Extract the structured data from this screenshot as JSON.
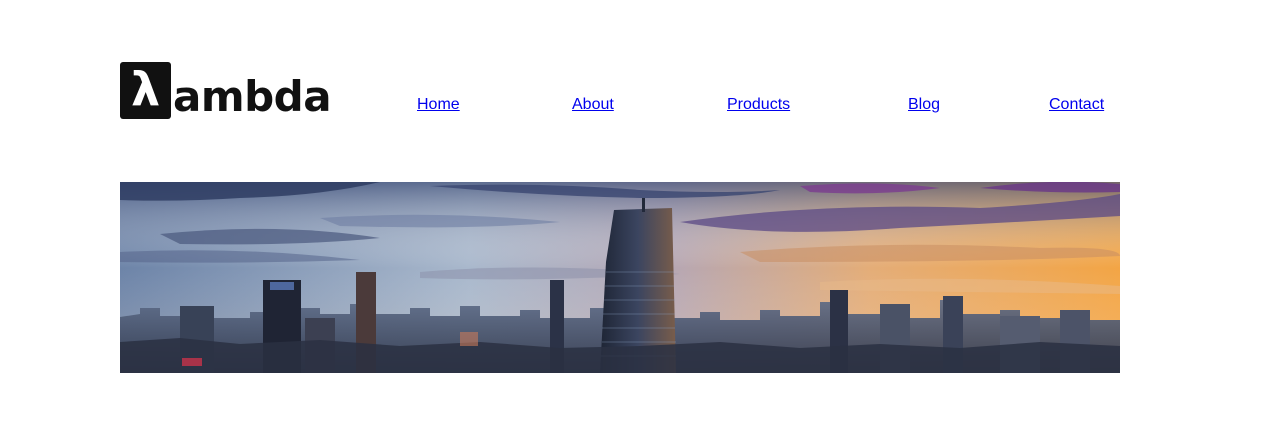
{
  "brand": {
    "logo_symbol": "λ",
    "logo_text": "ambda"
  },
  "nav": {
    "items": [
      {
        "label": "Home"
      },
      {
        "label": "About"
      },
      {
        "label": "Products"
      },
      {
        "label": "Blog"
      },
      {
        "label": "Contact"
      }
    ]
  },
  "hero": {
    "image": "city-skyline-sunset-photo"
  }
}
